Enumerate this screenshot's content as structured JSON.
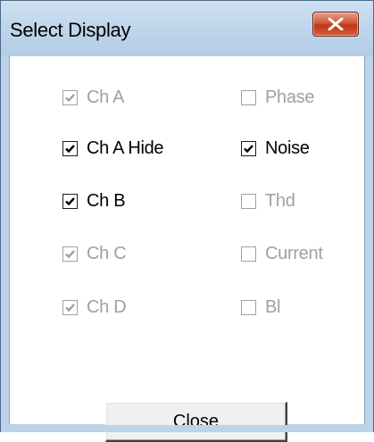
{
  "window": {
    "title": "Select Display"
  },
  "checkboxes": {
    "ch_a": {
      "label": "Ch A",
      "checked": true,
      "enabled": false
    },
    "ch_a_hide": {
      "label": "Ch A Hide",
      "checked": true,
      "enabled": true
    },
    "ch_b": {
      "label": "Ch B",
      "checked": true,
      "enabled": true
    },
    "ch_c": {
      "label": "Ch C",
      "checked": true,
      "enabled": false
    },
    "ch_d": {
      "label": "Ch D",
      "checked": true,
      "enabled": false
    },
    "phase": {
      "label": "Phase",
      "checked": false,
      "enabled": false
    },
    "noise": {
      "label": "Noise",
      "checked": true,
      "enabled": true
    },
    "thd": {
      "label": "Thd",
      "checked": false,
      "enabled": false
    },
    "current": {
      "label": "Current",
      "checked": false,
      "enabled": false
    },
    "bl": {
      "label": "Bl",
      "checked": false,
      "enabled": false
    }
  },
  "buttons": {
    "close_label": "Close"
  },
  "icons": {
    "window_close": "close-x-icon",
    "check": "checkmark-icon"
  },
  "colors": {
    "titlebar": "#bdd3e8",
    "close_button": "#c0371a",
    "disabled_text": "#a0a0a0"
  }
}
